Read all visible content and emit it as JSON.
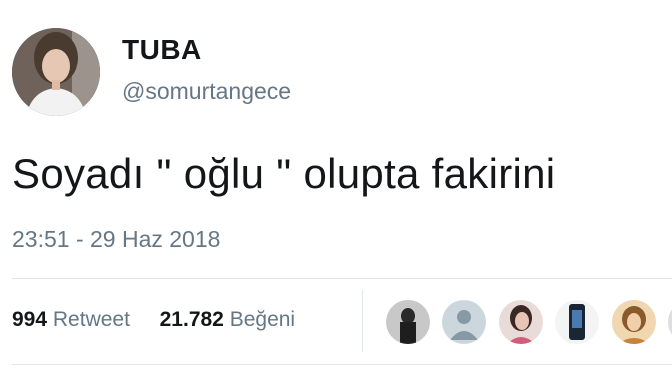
{
  "tweet": {
    "author_name": "TUBA",
    "author_handle": "@somurtangece",
    "text": "Soyadı \" oğlu \" olupta fakirini",
    "timestamp": "23:51 - 29 Haz 2018"
  },
  "stats": {
    "retweets_count": "994",
    "retweets_label": "Retweet",
    "likes_count": "21.782",
    "likes_label": "Beğeni"
  },
  "likers": [
    {
      "icon": "liker-avatar-1",
      "color": "#3a3a3a"
    },
    {
      "icon": "default-profile-icon",
      "color": "#b8c4cc"
    },
    {
      "icon": "liker-avatar-3",
      "color": "#c9a7a0"
    },
    {
      "icon": "liker-avatar-4",
      "color": "#2c3e50"
    },
    {
      "icon": "liker-avatar-5",
      "color": "#d9a56a"
    },
    {
      "icon": "liker-avatar-6",
      "color": "#9a9a9a"
    }
  ],
  "colors": {
    "text_primary": "#14171a",
    "text_secondary": "#657786",
    "divider": "#e1e8ed"
  }
}
